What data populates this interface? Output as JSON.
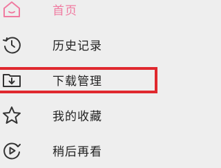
{
  "menu": {
    "items": [
      {
        "label": "首页",
        "icon": "home-icon",
        "active": true
      },
      {
        "label": "历史记录",
        "icon": "history-clock-icon"
      },
      {
        "label": "下载管理",
        "icon": "download-folder-icon"
      },
      {
        "label": "我的收藏",
        "icon": "star-icon"
      },
      {
        "label": "稍后再看",
        "icon": "watch-later-play-icon"
      }
    ]
  },
  "colors": {
    "background": "#eeeeee",
    "active_text": "#f07aa0",
    "text": "#222222",
    "icon": "#333333",
    "highlight_border": "#e0282e"
  }
}
